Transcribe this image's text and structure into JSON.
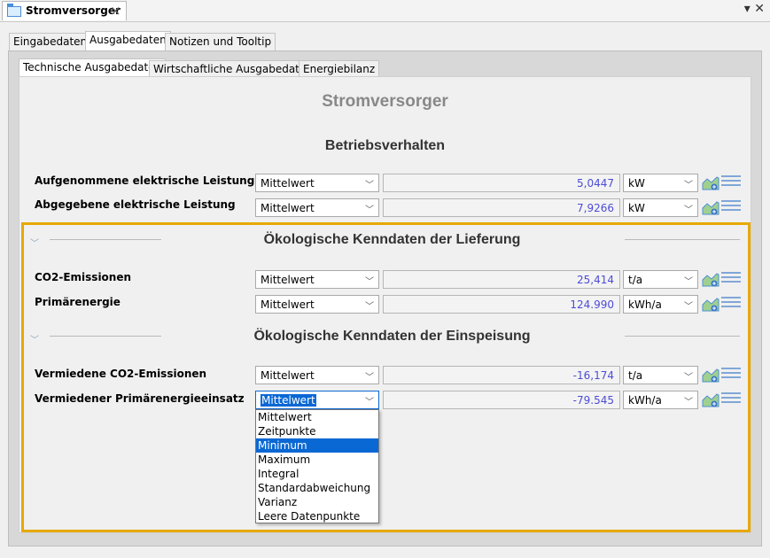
{
  "window": {
    "tab_title": "Stromversorger",
    "tab_close": "×",
    "controls": "▾ ✕"
  },
  "main_tabs": [
    "Eingabedaten",
    "Ausgabedaten",
    "Notizen und Tooltip"
  ],
  "sub_tabs": [
    "Technische Ausgabedaten",
    "Wirtschaftliche Ausgabedaten",
    "Energiebilanz"
  ],
  "page_title": "Stromversorger",
  "sections": {
    "betrieb": "Betriebsverhalten",
    "lieferung": "Ökologische Kenndaten der Lieferung",
    "einspeisung": "Ökologische Kenndaten der Einspeisung"
  },
  "rows": [
    {
      "label": "Aufgenommene elektrische Leistung",
      "mode": "Mittelwert",
      "value": "5,0447",
      "unit": "kW"
    },
    {
      "label": "Abgegebene elektrische Leistung",
      "mode": "Mittelwert",
      "value": "7,9266",
      "unit": "kW"
    },
    {
      "label": "CO2-Emissionen",
      "mode": "Mittelwert",
      "value": "25,414",
      "unit": "t/a"
    },
    {
      "label": "Primärenergie",
      "mode": "Mittelwert",
      "value": "124.990",
      "unit": "kWh/a"
    },
    {
      "label": "Vermiedene CO2-Emissionen",
      "mode": "Mittelwert",
      "value": "-16,174",
      "unit": "t/a"
    },
    {
      "label": "Vermiedener Primärenergieeinsatz",
      "mode": "Mittelwert",
      "value": "-79.545",
      "unit": "kWh/a"
    }
  ],
  "dropdown_options": [
    "Mittelwert",
    "Zeitpunkte",
    "Minimum",
    "Maximum",
    "Integral",
    "Standardabweichung",
    "Varianz",
    "Leere Datenpunkte"
  ],
  "dropdown_highlighted": "Minimum",
  "colors": {
    "accent": "#0a68d4",
    "highlight_border": "#e8a800",
    "value_text": "#4c4cd6"
  }
}
